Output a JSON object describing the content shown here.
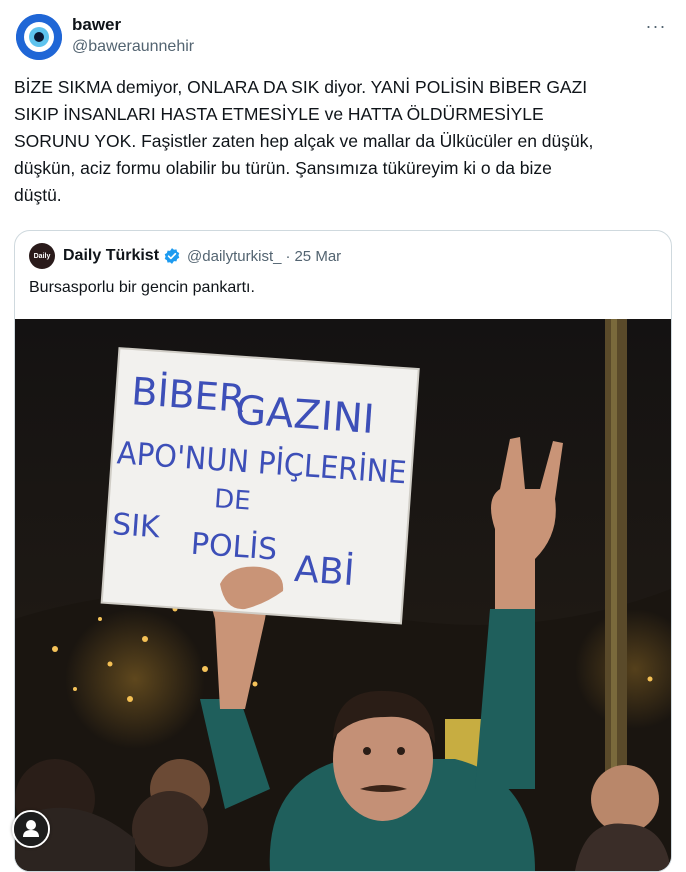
{
  "author": {
    "display_name": "bawer",
    "handle": "@baweraunnehir",
    "avatar_icon": "evil-eye-icon"
  },
  "more_icon": "more-horizontal-icon",
  "tweet": {
    "text": "BİZE SIKMA demiyor, ONLARA DA SIK diyor. YANİ POLİSİN BİBER GAZI\nSIKIP İNSANLARI HASTA ETMESİYLE ve HATTA ÖLDÜRMESİYLE\nSORUNU YOK. Faşistler zaten hep alçak ve mallar da Ülkücüler en düşük,\ndüşkün, aciz formu olabilir bu türün. Şansımıza tüküreyim ki o da bize\ndüştü."
  },
  "quote": {
    "display_name": "Daily Türkist",
    "handle": "@dailyturkist_",
    "separator": "·",
    "date": "25 Mar",
    "text": "Bursasporlu bir gencin pankartı.",
    "verified_icon": "verified-badge-icon",
    "avatar_label": "Daily",
    "sign_lines": [
      "BİBER",
      "GAZINI",
      "APO'NUN PİÇLERİNE",
      "DE",
      "SIK",
      "POLİS",
      "ABİ"
    ]
  },
  "colors": {
    "text": "#0f1419",
    "secondary": "#536471",
    "border": "#cfd9de",
    "verified": "#1d9bf0",
    "sign_ink": "#3d4fb8",
    "jacket": "#1f5f5c"
  },
  "fab_icon": "user-profile-icon"
}
